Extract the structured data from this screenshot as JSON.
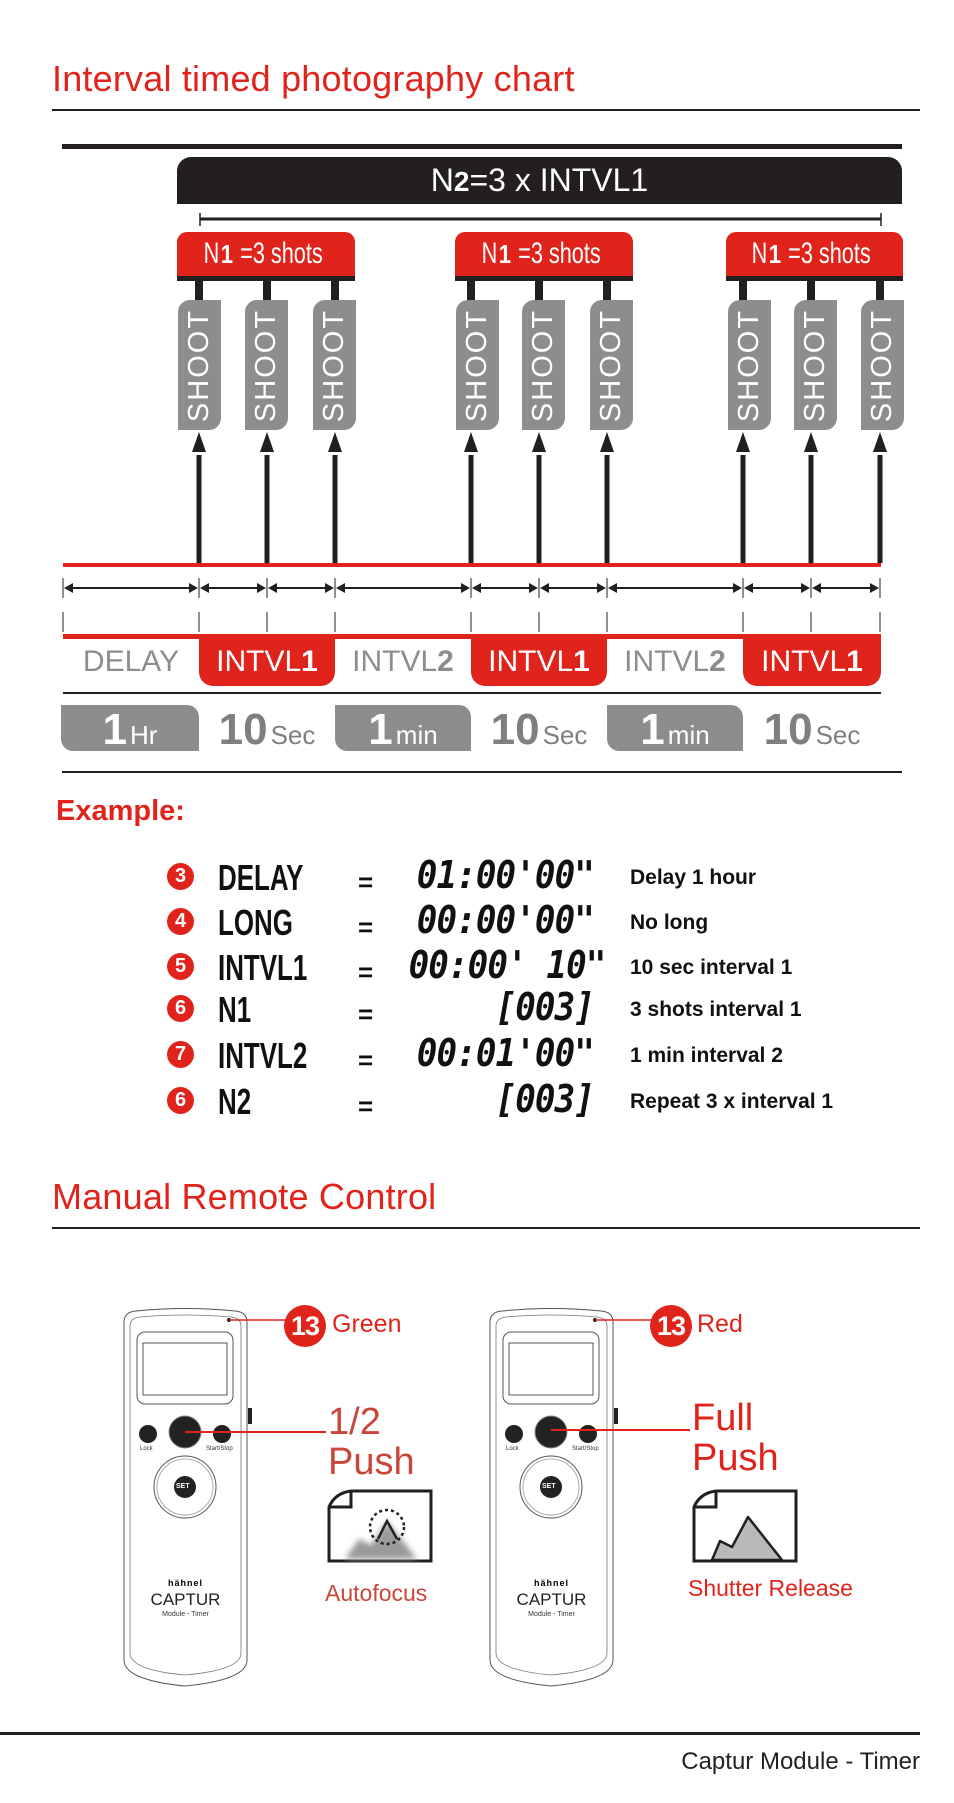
{
  "page": {
    "title": "Interval timed photography chart",
    "footer": "Captur Module - Timer"
  },
  "timeline": {
    "n2_label_prefix": "N",
    "n2_label_sub": "2",
    "n2_label_rest": "=3 x INTVL1",
    "groups": [
      {
        "prefix": "N",
        "sub": "1",
        "rest": "=3 shots",
        "shots": [
          "SHOOT",
          "SHOOT",
          "SHOOT"
        ]
      },
      {
        "prefix": "N",
        "sub": "1",
        "rest": "=3 shots",
        "shots": [
          "SHOOT",
          "SHOOT",
          "SHOOT"
        ]
      },
      {
        "prefix": "N",
        "sub": "1",
        "rest": "=3 shots",
        "shots": [
          "SHOOT",
          "SHOOT",
          "SHOOT"
        ]
      }
    ],
    "phases": [
      {
        "name": "DELAY",
        "suffix": "",
        "highlight": false
      },
      {
        "name": "INTVL",
        "suffix": "1",
        "highlight": true
      },
      {
        "name": "INTVL",
        "suffix": "2",
        "highlight": false
      },
      {
        "name": "INTVL",
        "suffix": "1",
        "highlight": true
      },
      {
        "name": "INTVL",
        "suffix": "2",
        "highlight": false
      },
      {
        "name": "INTVL",
        "suffix": "1",
        "highlight": true
      }
    ],
    "durations": [
      {
        "value": "1",
        "unit": "Hr",
        "filled": true
      },
      {
        "value": "10",
        "unit": "Sec",
        "filled": false
      },
      {
        "value": "1",
        "unit": "min",
        "filled": true
      },
      {
        "value": "10",
        "unit": "Sec",
        "filled": false
      },
      {
        "value": "1",
        "unit": "min",
        "filled": true
      },
      {
        "value": "10",
        "unit": "Sec",
        "filled": false
      }
    ]
  },
  "example": {
    "title": "Example:",
    "rows": [
      {
        "step": "3",
        "label": "DELAY",
        "eq": "=",
        "value": "01:00'00\"",
        "desc": "Delay 1 hour"
      },
      {
        "step": "4",
        "label": "LONG",
        "eq": "=",
        "value": "00:00'00\"",
        "desc": "No long"
      },
      {
        "step": "5",
        "label": "INTVL1",
        "eq": "=",
        "value": "00:00' 10\"",
        "desc": "10 sec interval 1"
      },
      {
        "step": "6",
        "label": "N1",
        "eq": "=",
        "value": "[003]",
        "desc": "3 shots interval 1"
      },
      {
        "step": "7",
        "label": "INTVL2",
        "eq": "=",
        "value": "00:01'00\"",
        "desc": "1 min interval 2"
      },
      {
        "step": "6",
        "label": "N2",
        "eq": "=",
        "value": "[003]",
        "desc": "Repeat 3 x interval 1"
      }
    ]
  },
  "manual": {
    "title": "Manual Remote Control",
    "remotes": [
      {
        "led_badge": "13",
        "led_label": "Green",
        "push_label": "1/2\nPush",
        "caption": "Autofocus",
        "buttons": {
          "lock": "Lock",
          "start_stop": "Start/Stop",
          "set": "SET"
        },
        "brand": "hähnel",
        "product": "CAPTUR",
        "model": "Module - Timer"
      },
      {
        "led_badge": "13",
        "led_label": "Red",
        "push_label": "Full\nPush",
        "caption": "Shutter Release",
        "buttons": {
          "lock": "Lock",
          "start_stop": "Start/Stop",
          "set": "SET"
        },
        "brand": "hähnel",
        "product": "CAPTUR",
        "model": "Module - Timer"
      }
    ]
  },
  "colors": {
    "accent_red": "#e0241b",
    "dark": "#231f20",
    "gray": "#8e8d8d"
  }
}
